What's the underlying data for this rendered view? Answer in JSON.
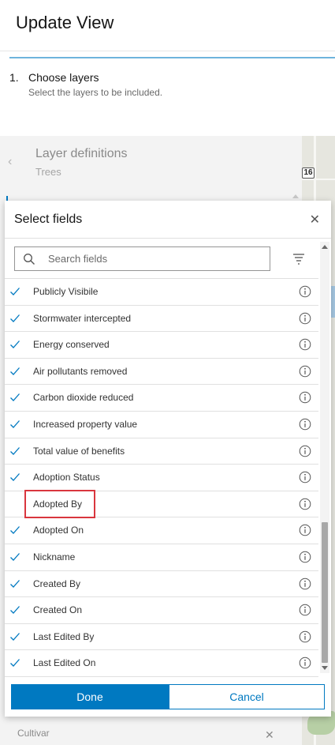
{
  "page": {
    "title": "Update View"
  },
  "step": {
    "number": "1.",
    "title": "Choose layers",
    "description": "Select the layers to be included."
  },
  "background_panel": {
    "title": "Layer definitions",
    "subtitle": "Trees",
    "footer_label": "Cultivar",
    "map_shield_label": "16"
  },
  "modal": {
    "title": "Select fields",
    "close_glyph": "✕",
    "search": {
      "placeholder": "Search fields",
      "value": ""
    },
    "fields": [
      {
        "label": "Publicly Visibile",
        "checked": true
      },
      {
        "label": "Stormwater intercepted",
        "checked": true
      },
      {
        "label": "Energy conserved",
        "checked": true
      },
      {
        "label": "Air pollutants removed",
        "checked": true
      },
      {
        "label": "Carbon dioxide reduced",
        "checked": true
      },
      {
        "label": "Increased property value",
        "checked": true
      },
      {
        "label": "Total value of benefits",
        "checked": true
      },
      {
        "label": "Adoption Status",
        "checked": true
      },
      {
        "label": "Adopted By",
        "checked": false,
        "highlighted": true
      },
      {
        "label": "Adopted On",
        "checked": true
      },
      {
        "label": "Nickname",
        "checked": true
      },
      {
        "label": "Created By",
        "checked": true
      },
      {
        "label": "Created On",
        "checked": true
      },
      {
        "label": "Last Edited By",
        "checked": true
      },
      {
        "label": "Last Edited On",
        "checked": true
      }
    ],
    "buttons": {
      "done": "Done",
      "cancel": "Cancel"
    }
  },
  "colors": {
    "accent": "#0079c1",
    "highlight": "#d9363e"
  }
}
